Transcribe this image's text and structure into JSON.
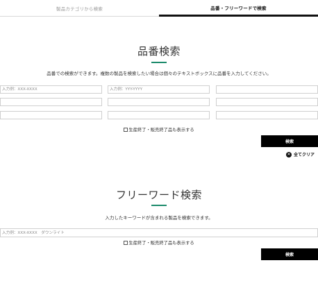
{
  "tabs": [
    {
      "label": "製品カテゴリから検索",
      "active": false
    },
    {
      "label": "品番・フリーワードで検索",
      "active": true
    }
  ],
  "part_search": {
    "title": "品番検索",
    "description": "品番での検索ができます。複数の製品を検索したい場合は個々のテキストボックスに品番を入力してください。",
    "placeholders": [
      "入力例：XXX-XXXX",
      "入力例：YYY-YYYY"
    ],
    "checkbox_label": "生産終了・販売終了品も表示する",
    "checkbox_checked": false,
    "search_button": "検索",
    "clear_all": "全てクリア",
    "clear_icon": "close-circle-icon"
  },
  "free_search": {
    "title": "フリーワード検索",
    "description": "入力したキーワードが含まれる製品を検索できます。",
    "placeholder": "入力例：XXX-XXXX　ダウンライト",
    "checkbox_label": "生産終了・販売終了品も表示する",
    "checkbox_checked": false,
    "search_button": "検索"
  },
  "colors": {
    "accent": "#1a8a6a",
    "button_bg": "#000000",
    "active_tab_border": "#111111"
  }
}
